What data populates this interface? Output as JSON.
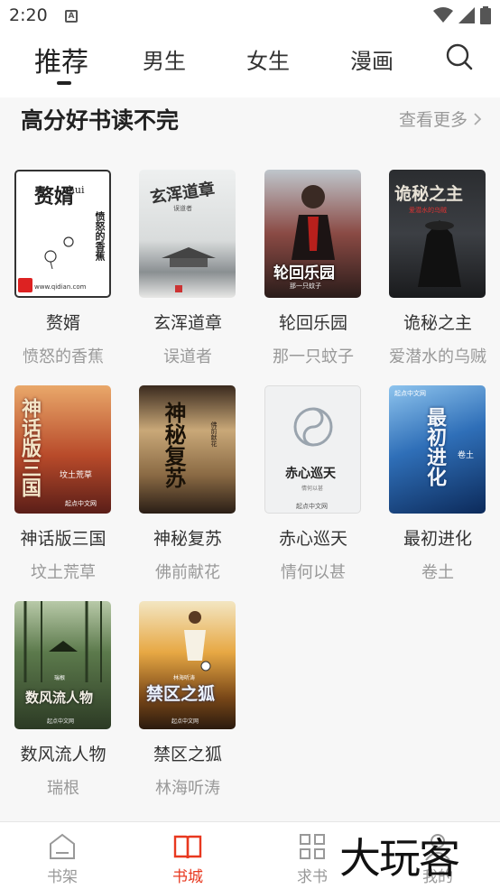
{
  "status_bar": {
    "time": "2:20",
    "notification_icon": "a-notification-icon",
    "wifi_icon": "wifi-icon",
    "signal_icon": "signal-icon",
    "battery_icon": "battery-icon"
  },
  "top_tabs": [
    {
      "label": "推荐",
      "active": true
    },
    {
      "label": "男生",
      "active": false
    },
    {
      "label": "女生",
      "active": false
    },
    {
      "label": "漫画",
      "active": false
    }
  ],
  "search_icon": "search-icon",
  "section": {
    "title": "高分好书读不完",
    "more_label": "查看更多"
  },
  "books": [
    {
      "title": "赘婿",
      "author": "愤怒的香蕉",
      "cover_title": "赘婿",
      "cover_sub": "zhui",
      "cover_author": "愤怒的香蕉",
      "cover_site": "www.qidian.com"
    },
    {
      "title": "玄浑道章",
      "author": "误道者",
      "cover_title": "玄浑道章",
      "cover_author": "误道者"
    },
    {
      "title": "轮回乐园",
      "author": "那一只蚊子",
      "cover_title": "轮回乐园",
      "cover_author": "那一只蚊子"
    },
    {
      "title": "诡秘之主",
      "author": "爱潜水的乌贼",
      "cover_title": "诡秘之主",
      "cover_author": "爱潜水的乌贼"
    },
    {
      "title": "神话版三国",
      "author": "坟土荒草",
      "cover_title": "神话版三国",
      "cover_author": "坟土荒草",
      "cover_site": "起点中文网"
    },
    {
      "title": "神秘复苏",
      "author": "佛前献花",
      "cover_title": "神秘复苏",
      "cover_author": "佛前献花"
    },
    {
      "title": "赤心巡天",
      "author": "情何以甚",
      "cover_title": "赤心巡天",
      "cover_author": "情何以甚",
      "cover_site": "起点中文网"
    },
    {
      "title": "最初进化",
      "author": "卷土",
      "cover_title": "最初进化",
      "cover_author": "卷土",
      "cover_site": "起点中文网"
    },
    {
      "title": "数风流人物",
      "author": "瑞根",
      "cover_title": "数风流人物",
      "cover_author": "瑞根",
      "cover_site": "起点中文网"
    },
    {
      "title": "禁区之狐",
      "author": "林海听涛",
      "cover_title": "禁区之狐",
      "cover_author": "林海听涛",
      "cover_site": "起点中文网"
    }
  ],
  "bottom_nav": [
    {
      "label": "书架",
      "icon": "bookshelf-icon",
      "active": false
    },
    {
      "label": "书城",
      "icon": "open-book-icon",
      "active": true
    },
    {
      "label": "求书",
      "icon": "grid-icon",
      "active": false
    },
    {
      "label": "我的",
      "icon": "user-icon",
      "active": false
    }
  ],
  "watermark": "大玩客",
  "colors": {
    "accent": "#e8381f",
    "muted": "#999999",
    "text": "#333333",
    "background": "#f7f7f7"
  }
}
